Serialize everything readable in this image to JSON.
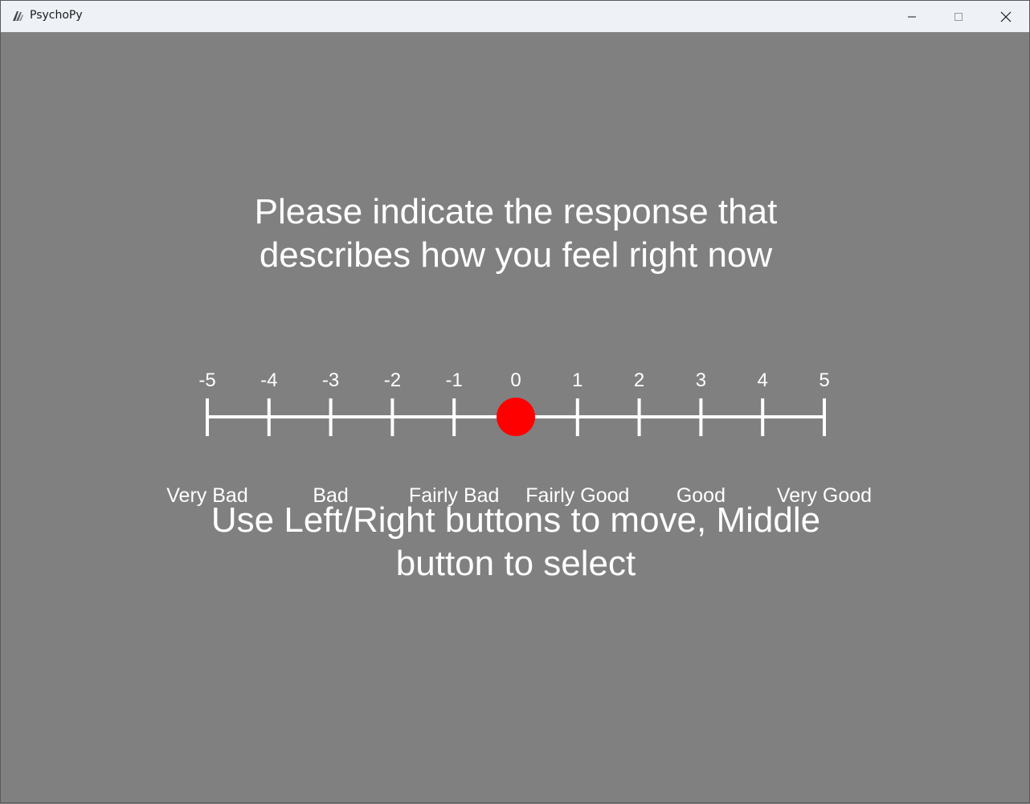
{
  "window": {
    "title": "PsychoPy",
    "controls": {
      "minimize_icon": "minimize-icon",
      "maximize_icon": "maximize-icon",
      "close_icon": "close-icon"
    }
  },
  "stimulus": {
    "background_color": "#808080",
    "text_color": "#ffffff",
    "prompt_line1": "Please indicate the response that",
    "prompt_line2": "describes how you feel right now",
    "instruction_line1": "Use Left/Right buttons to move, Middle",
    "instruction_line2": "button to select"
  },
  "rating_scale": {
    "tick_labels": [
      "-5",
      "-4",
      "-3",
      "-2",
      "-1",
      "0",
      "1",
      "2",
      "3",
      "4",
      "5"
    ],
    "anchor_labels": [
      {
        "text": "Very Bad",
        "value": -5
      },
      {
        "text": "Bad",
        "value": -3
      },
      {
        "text": "Fairly Bad",
        "value": -1
      },
      {
        "text": "Fairly Good",
        "value": 1
      },
      {
        "text": "Good",
        "value": 3
      },
      {
        "text": "Very Good",
        "value": 5
      }
    ],
    "min": -5,
    "max": 5,
    "selected_value": 0,
    "marker_color": "#ff0000",
    "line_color": "#ffffff"
  }
}
